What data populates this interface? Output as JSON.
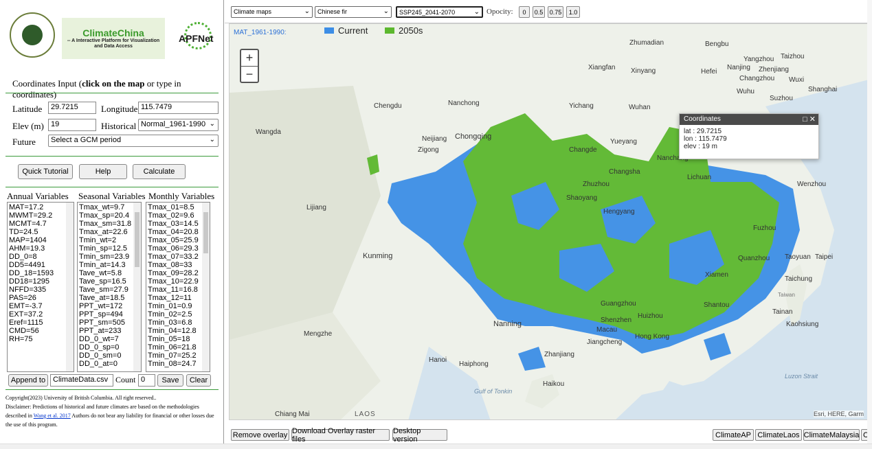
{
  "left_panel": {
    "logos": {
      "cfcg": "CFCG",
      "climatechina_title": "ClimateChina",
      "climatechina_subtitle_1": "-- A Interactive Platform for Visualization",
      "climatechina_subtitle_2": "and Data Access",
      "apfnet": "APFNet"
    },
    "coord_title_prefix": "Coordinates Input (",
    "coord_title_bold": "click on the map",
    "coord_title_suffix": " or type in coordinates)",
    "latitude_label": "Latitude",
    "latitude_value": "29.7215",
    "longitude_label": "Longitude",
    "longitude_value": "115.7479",
    "elev_label": "Elev (m)",
    "elev_value": "19",
    "historical_label": "Historical",
    "historical_value": "Normal_1961-1990",
    "future_label": "Future",
    "future_value": "Select a GCM period",
    "buttons": {
      "tutorial": "Quick Tutorial",
      "help": "Help",
      "calculate": "Calculate"
    },
    "annual_header": "Annual Variables",
    "seasonal_header": "Seasonal Variables",
    "monthly_header": "Monthly Variables",
    "annual": [
      "MAT=17.2",
      "MWMT=29.2",
      "MCMT=4.7",
      "TD=24.5",
      "MAP=1404",
      "AHM=19.3",
      "DD_0=8",
      "DD5=4491",
      "DD_18=1593",
      "DD18=1295",
      "NFFD=335",
      "PAS=26",
      "EMT=-3.7",
      "EXT=37.2",
      "Eref=1115",
      "CMD=56",
      "RH=75"
    ],
    "seasonal": [
      "Tmax_wt=9.7",
      "Tmax_sp=20.4",
      "Tmax_sm=31.8",
      "Tmax_at=22.6",
      "Tmin_wt=2",
      "Tmin_sp=12.5",
      "Tmin_sm=23.9",
      "Tmin_at=14.3",
      "Tave_wt=5.8",
      "Tave_sp=16.5",
      "Tave_sm=27.9",
      "Tave_at=18.5",
      "PPT_wt=172",
      "PPT_sp=494",
      "PPT_sm=505",
      "PPT_at=233",
      "DD_0_wt=7",
      "DD_0_sp=0",
      "DD_0_sm=0",
      "DD_0_at=0"
    ],
    "monthly": [
      "Tmax_01=8.5",
      "Tmax_02=9.6",
      "Tmax_03=14.5",
      "Tmax_04=20.8",
      "Tmax_05=25.9",
      "Tmax_06=29.3",
      "Tmax_07=33.2",
      "Tmax_08=33",
      "Tmax_09=28.2",
      "Tmax_10=22.9",
      "Tmax_11=16.8",
      "Tmax_12=11",
      "Tmin_01=0.9",
      "Tmin_02=2.5",
      "Tmin_03=6.8",
      "Tmin_04=12.8",
      "Tmin_05=18",
      "Tmin_06=21.8",
      "Tmin_07=25.2",
      "Tmin_08=24.7"
    ],
    "append_label": "Append to",
    "file_value": "ClimateData.csv",
    "count_label": "Count",
    "count_value": "0",
    "save_label": "Save",
    "clear_label": "Clear",
    "footer_copyright": "Copyright(2023) University of British Columbia. All right reserved..",
    "footer_disclaimer_1": "Disclaimer: Predictions of historical and future climates are based on the methodologies described in ",
    "footer_link": "Wang et al. 2017",
    "footer_disclaimer_2": " Authors do not bear any liability for financial or other losses due the use of this program."
  },
  "top_controls": {
    "map_type": "Climate maps",
    "species": "Chinese fir",
    "scenario": "SSP245_2041-2070",
    "opacity_label": "Opocity:",
    "opacity_options": [
      "0",
      "0.5",
      "0.75",
      "1.0"
    ]
  },
  "map": {
    "layer_label": "MAT_1961-1990:",
    "legend": [
      {
        "name": "Current",
        "color": "#3d8ee6"
      },
      {
        "name": "2050s",
        "color": "#5cb82e"
      }
    ],
    "attribution": "Esri, HERE, Garm",
    "places": [
      "Zhumadian",
      "Bengbu",
      "Taizhou",
      "Yangzhou",
      "Nanjing",
      "Zhenjiang",
      "Xiangfan",
      "Xinyang",
      "Hefei",
      "Changzhou",
      "Wuxi",
      "Shanghai",
      "Wuhu",
      "Suzhou",
      "Chengdu",
      "Nanchong",
      "Yichang",
      "Wuhan",
      "Wangda",
      "Neijiang",
      "Zigong",
      "Chongqing",
      "Changde",
      "Yueyang",
      "Nanchang",
      "Changsha",
      "Zhuzhou",
      "Shaoyang",
      "Hengyang",
      "Lichuan",
      "Wenzhou",
      "Fuzhou",
      "Lijiang",
      "Kunming",
      "Quanzhou",
      "Taoyuan",
      "Taipei",
      "Taichung",
      "Xiamen",
      "Guangzhou",
      "Shantou",
      "Tainan",
      "Kaohsiung",
      "Nanning",
      "Shenzhen",
      "Huizhou",
      "Macau",
      "Hong Kong",
      "Jiangcheng",
      "Mengzhe",
      "Hanoi",
      "Haiphong",
      "Zhanjiang",
      "Haikou",
      "Gulf of Tonkin",
      "Luzon Strait",
      "Chiang Mai",
      "LAOS",
      "Taiwan"
    ],
    "popup": {
      "title": "Coordinates",
      "lat": "lat : 29.7215",
      "lon": "lon : 115.7479",
      "elev": "elev : 19 m"
    }
  },
  "bottom": {
    "remove_overlay": "Remove overlay",
    "download": "Download Overlay raster files",
    "desktop": "Desktop version",
    "links": [
      "ClimateAP",
      "ClimateLaos",
      "ClimateMalaysia",
      "C"
    ]
  }
}
